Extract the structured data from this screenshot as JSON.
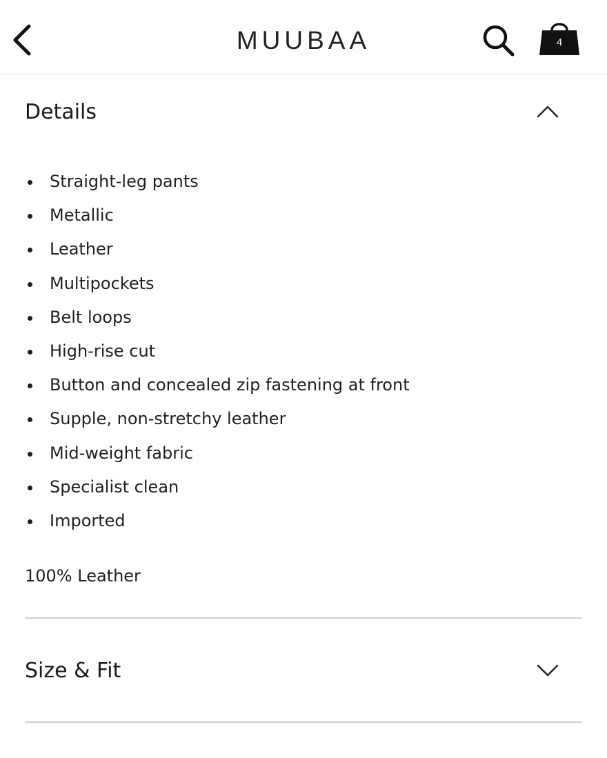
{
  "header": {
    "brand": "MUUBAA",
    "back_icon": "chevron-left-icon",
    "search_icon": "search-icon",
    "bag_icon": "shopping-bag-icon",
    "bag_count": "4"
  },
  "details": {
    "title": "Details",
    "expanded": true,
    "toggle_icon": "chevron-up-icon",
    "items": [
      "Straight-leg pants",
      "Metallic",
      "Leather",
      "Multipockets",
      "Belt loops",
      "High-rise cut",
      "Button and concealed zip fastening at front",
      "Supple, non-stretchy leather",
      "Mid-weight fabric",
      "Specialist clean",
      "Imported"
    ],
    "composition": "100% Leather"
  },
  "size_fit": {
    "title": "Size & Fit",
    "expanded": false,
    "toggle_icon": "chevron-down-icon"
  },
  "colors": {
    "text": "#1a1a1a",
    "divider": "#d0d0d0",
    "background": "#ffffff"
  }
}
